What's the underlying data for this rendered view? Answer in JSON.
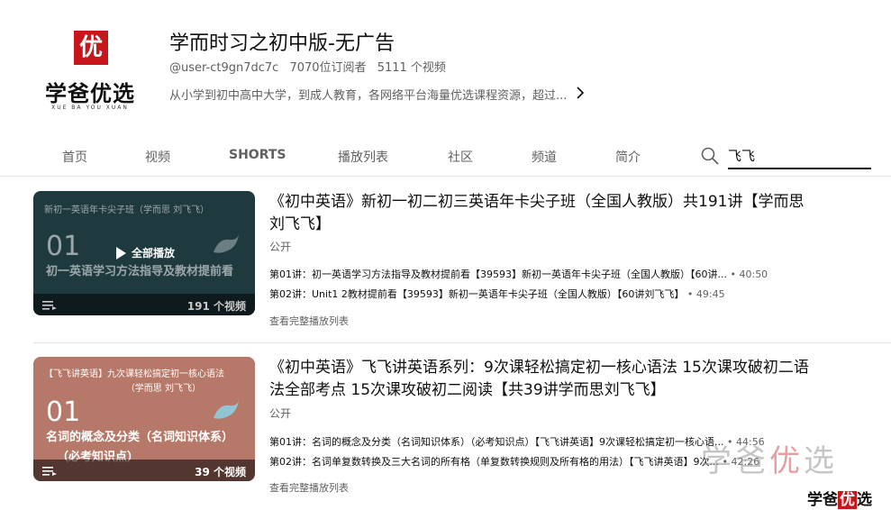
{
  "channel": {
    "logo_seal": "优",
    "logo_name": "学爸优选",
    "logo_sub": "XUE BA YOU XUAN",
    "title": "学而时习之初中版-无广告",
    "handle": "@user-ct9gn7dc7c",
    "subscribers": "7070位订阅者",
    "videos": "5111 个视频",
    "description": "从小学到初中高中大学，到成人教育，各网络平台海量优选课程资源，超过..."
  },
  "tabs": {
    "home": "首页",
    "videos": "视频",
    "shorts": "SHORTS",
    "playlists": "播放列表",
    "community": "社区",
    "channels": "频道",
    "about": "简介"
  },
  "search": {
    "value": "飞飞"
  },
  "playlists": [
    {
      "title": "《初中英语》新初一初二初三英语年卡尖子班（全国人教版）共191讲【学而思刘飞飞】",
      "visibility": "公开",
      "thumb_top": "新初一英语年卡尖子班（学而思 刘飞飞）",
      "thumb_num": "01",
      "thumb_line": "初一英语学习方法指导及教材提前看",
      "play_all": "全部播放",
      "video_count": "191 个视频",
      "episodes": [
        {
          "title": "第01讲：初一英语学习方法指导及教材提前看【39593】新初一英语年卡尖子班（全国人教版）【60讲...",
          "duration": "40:50"
        },
        {
          "title": "第02讲：Unit1 2教材提前看【39593】新初一英语年卡尖子班（全国人教版）【60讲刘飞飞】",
          "duration": "49:45"
        }
      ],
      "view_full": "查看完整播放列表"
    },
    {
      "title": "《初中英语》飞飞讲英语系列：9次课轻松搞定初一核心语法 15次课攻破初二语法全部考点 15次课攻破初二阅读【共39讲学而思刘飞飞】",
      "visibility": "公开",
      "thumb_top": "【飞飞讲英语】九次课轻松搞定初一核心语法",
      "thumb_top2": "（学而思 刘飞飞）",
      "thumb_num": "01",
      "thumb_line": "名词的概念及分类（名词知识体系）",
      "thumb_line2": "（必考知识点）",
      "video_count": "39 个视频",
      "episodes": [
        {
          "title": "第01讲：名词的概念及分类（名词知识体系）（必考知识点）【飞飞讲英语】9次课轻松搞定初一核心语...",
          "duration": "44:56"
        },
        {
          "title": "第02讲：名词单复数转换及三大名词的所有格（单复数转换规则及所有格的用法）【飞飞讲英语】9次...",
          "duration": "42:26"
        }
      ],
      "view_full": "查看完整播放列表"
    }
  ],
  "watermark": {
    "big": "学爸",
    "big_red": "优",
    "big_end": "选",
    "small": "学爸",
    "small_red": "优",
    "small_end": "选"
  },
  "colors": {
    "brand_red": "#c8161d",
    "thumb1_bg": "#1f3a3f",
    "thumb2_bg": "#b67868"
  }
}
